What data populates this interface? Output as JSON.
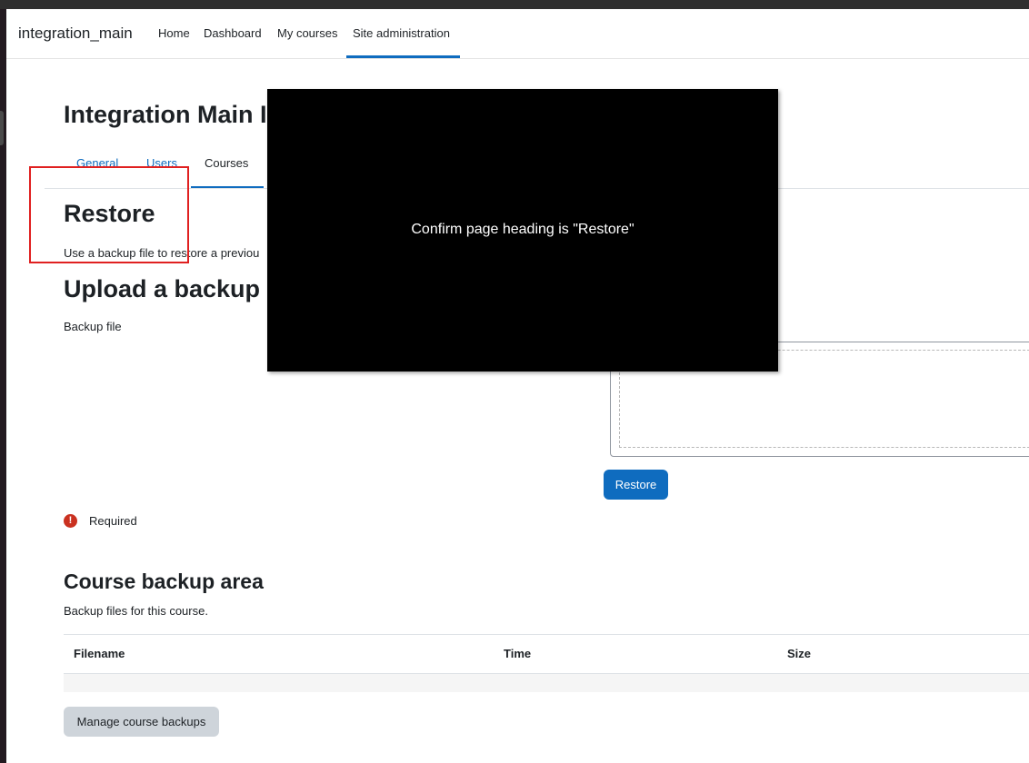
{
  "navbar": {
    "brand": "integration_main",
    "items": [
      {
        "label": "Home"
      },
      {
        "label": "Dashboard"
      },
      {
        "label": "My courses"
      },
      {
        "label": "Site administration"
      }
    ]
  },
  "page": {
    "title": "Integration Main I",
    "tabs": [
      {
        "label": "General"
      },
      {
        "label": "Users"
      },
      {
        "label": "Courses"
      }
    ]
  },
  "restore": {
    "heading": "Restore",
    "intro": "Use a backup file to restore a previou"
  },
  "upload": {
    "heading": "Upload a backup",
    "file_label": "Backup file",
    "restore_button": "Restore"
  },
  "form": {
    "required_icon": "!",
    "required_label": "Required"
  },
  "backup_area": {
    "heading": "Course backup area",
    "description": "Backup files for this course.",
    "columns": [
      "Filename",
      "Time",
      "Size"
    ],
    "manage_button": "Manage course backups"
  },
  "overlay": {
    "message": "Confirm page heading is \"Restore\""
  },
  "colors": {
    "accent": "#0f6cbf",
    "highlight": "#e02020",
    "required": "#ca3120"
  }
}
